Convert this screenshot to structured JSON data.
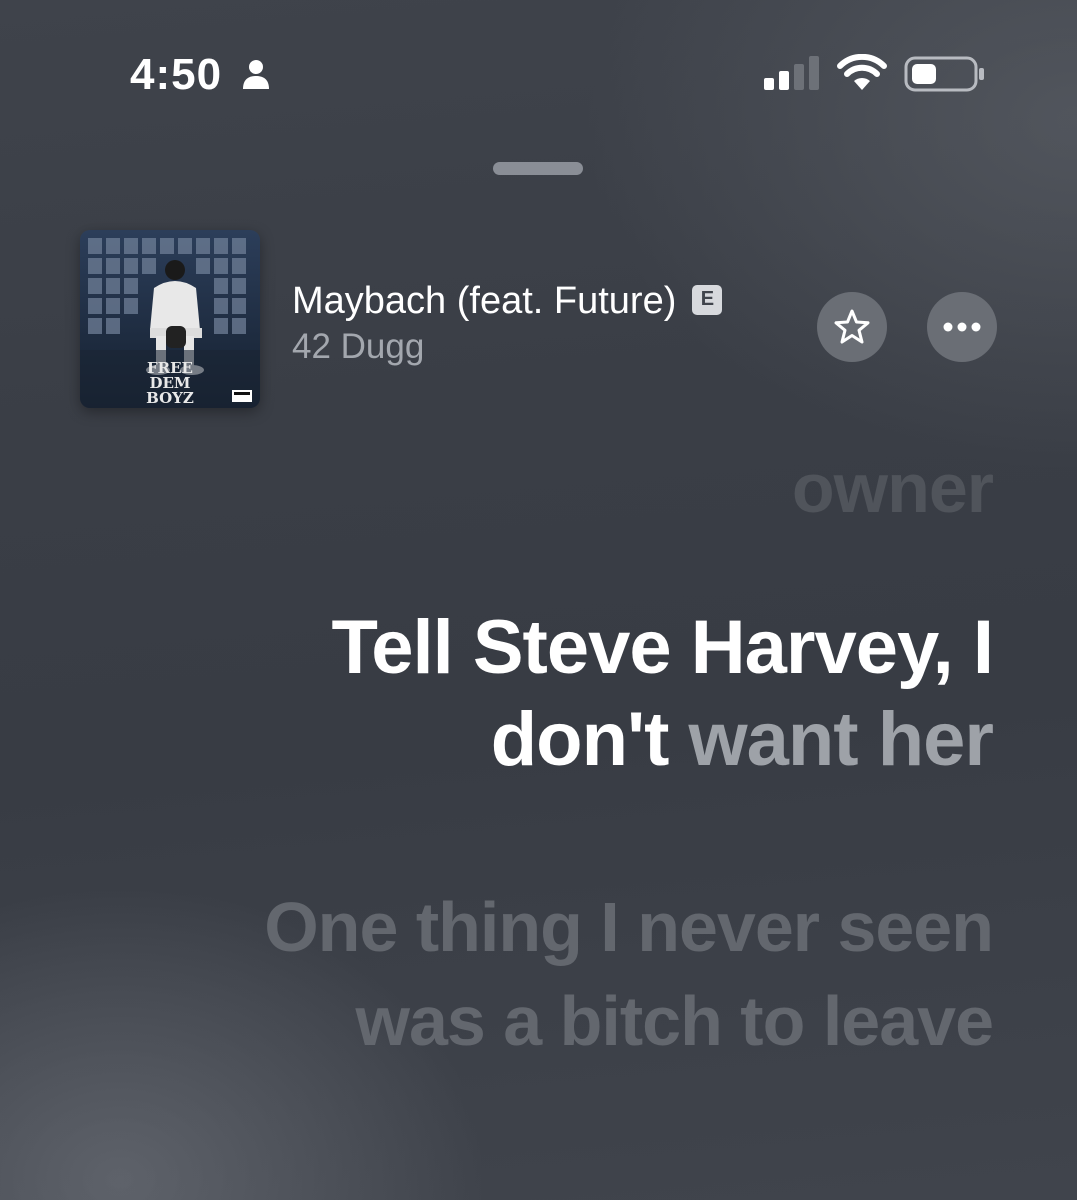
{
  "status_bar": {
    "time": "4:50",
    "focus_icon": "person-icon",
    "signal_icon": "cellular-signal-icon",
    "wifi_icon": "wifi-icon",
    "battery_icon": "battery-icon",
    "signal_bars_filled": 2,
    "signal_bars_total": 4,
    "battery_level": 0.35
  },
  "now_playing": {
    "artwork_text_line1": "FREE",
    "artwork_text_line2": "DEM",
    "artwork_text_line3": "BOYZ",
    "title": "Maybach (feat. Future)",
    "explicit_badge": "E",
    "artist": "42 Dugg",
    "favorite_icon": "star-icon",
    "more_icon": "ellipsis-icon"
  },
  "lyrics": {
    "previous": "owner",
    "current_sung": "Tell Steve Harvey, I don't",
    "current_unsung": " want her",
    "next": "One thing I never seen was a bitch to leave"
  },
  "colors": {
    "background": "#3a3e46",
    "lyric_active": "#ffffff",
    "lyric_inactive": "#63676e",
    "button_fill": "#6a6e75"
  }
}
